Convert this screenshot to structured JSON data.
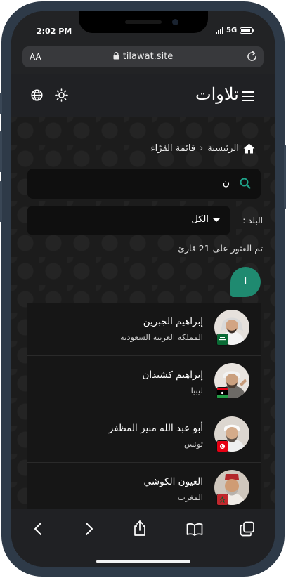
{
  "status_bar": {
    "time": "2:02 PM",
    "network": "5G",
    "battery_level": 0.85
  },
  "browser": {
    "text_size_label": "AA",
    "url": "tilawat.site"
  },
  "app": {
    "logo_text": "تلاوات"
  },
  "breadcrumb": {
    "home": "الرئيسية",
    "separator": "‹",
    "current": "قائمة القرّاء"
  },
  "search": {
    "value": "ن"
  },
  "filter": {
    "label": "البلد :",
    "selected": "الكل"
  },
  "results": {
    "count_text": "تم العثور على 21 قارئ"
  },
  "letter_header": "ا",
  "reciters": [
    {
      "name": "إبراهيم الجبرين",
      "country": "المملكة العربية السعودية",
      "flag": "saudi-arabia"
    },
    {
      "name": "إبراهيم كشيدان",
      "country": "ليبيا",
      "flag": "libya"
    },
    {
      "name": "أبو عبد الله منير المظفر",
      "country": "تونس",
      "flag": "tunisia"
    },
    {
      "name": "العيون الكوشي",
      "country": "المغرب",
      "flag": "morocco"
    }
  ],
  "colors": {
    "accent": "#1f8a70",
    "background": "#1c1c1c",
    "card": "#161616"
  }
}
